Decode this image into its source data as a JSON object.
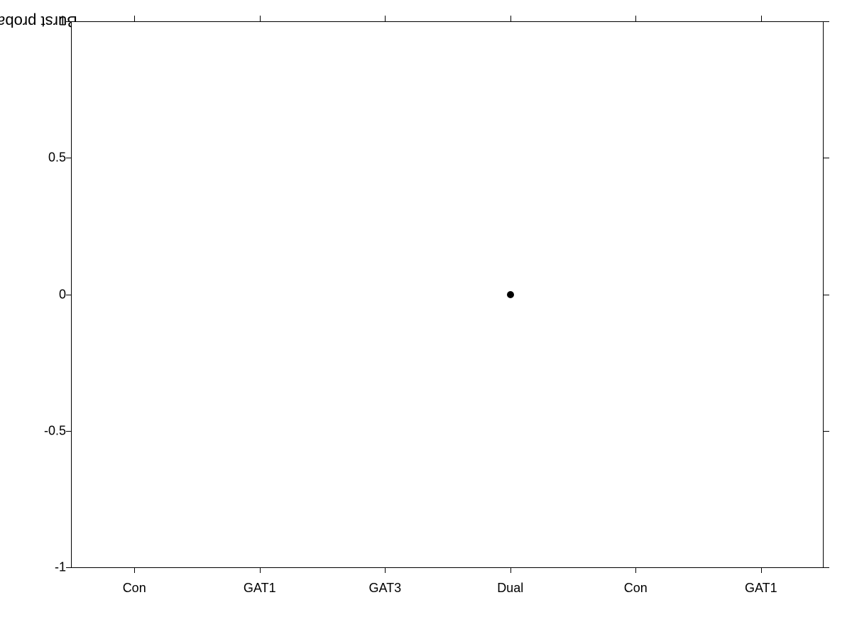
{
  "chart": {
    "y_axis_label": "Burst probability",
    "y_ticks": [
      {
        "value": "1",
        "percent": 0
      },
      {
        "value": "0.5",
        "percent": 25
      },
      {
        "value": "0",
        "percent": 50
      },
      {
        "value": "-0.5",
        "percent": 75
      },
      {
        "value": "-1",
        "percent": 100
      }
    ],
    "x_ticks": [
      {
        "label": "Con",
        "percent": 8.33
      },
      {
        "label": "GAT1",
        "percent": 25
      },
      {
        "label": "GAT3",
        "percent": 41.67
      },
      {
        "label": "Dual",
        "percent": 58.33
      },
      {
        "label": "Con",
        "percent": 75
      },
      {
        "label": "GAT1",
        "percent": 91.67
      }
    ],
    "data_points": [
      {
        "x_percent": 58.33,
        "y_value": 0
      }
    ]
  }
}
